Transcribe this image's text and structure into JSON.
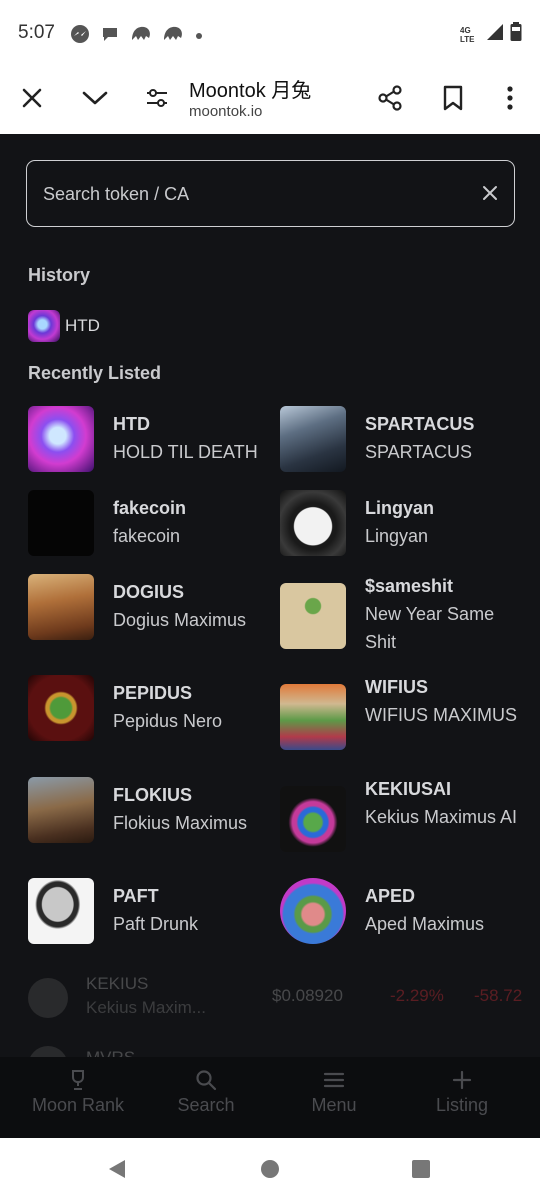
{
  "status": {
    "time": "5:07",
    "network": "4G LTE"
  },
  "browser": {
    "title": "Moontok 月兔",
    "url": "moontok.io"
  },
  "search": {
    "placeholder": "Search token / CA"
  },
  "history": {
    "title": "History",
    "items": [
      {
        "label": "HTD"
      }
    ]
  },
  "recent": {
    "title": "Recently Listed",
    "tokens": [
      {
        "symbol": "HTD",
        "name": "HOLD TIL DEATH"
      },
      {
        "symbol": "SPARTACUS",
        "name": "SPARTACUS"
      },
      {
        "symbol": "fakecoin",
        "name": "fakecoin"
      },
      {
        "symbol": "Lingyan",
        "name": "Lingyan"
      },
      {
        "symbol": "DOGIUS",
        "name": "Dogius Maximus"
      },
      {
        "symbol": "$sameshit",
        "name": "New Year Same Shit"
      },
      {
        "symbol": "PEPIDUS",
        "name": "Pepidus Nero"
      },
      {
        "symbol": "WIFIUS",
        "name": "WIFIUS MAXIMUS"
      },
      {
        "symbol": "FLOKIUS",
        "name": "Flokius Maximus"
      },
      {
        "symbol": "KEKIUSAI",
        "name": "Kekius Maximus AI"
      },
      {
        "symbol": "PAFT",
        "name": "Paft Drunk"
      },
      {
        "symbol": "APED",
        "name": "Aped Maximus"
      }
    ]
  },
  "background_rows": [
    {
      "symbol": "KEKIUS",
      "name": "Kekius Maxim...",
      "price": "$0.08920",
      "change1": "-2.29%",
      "change2": "-58.72"
    },
    {
      "symbol": "MVRS",
      "name": "",
      "price": "",
      "change1": "",
      "change2": ""
    }
  ],
  "tabs": [
    {
      "label": "Moon Rank",
      "icon": "trophy-icon"
    },
    {
      "label": "Search",
      "icon": "search-icon"
    },
    {
      "label": "Menu",
      "icon": "menu-icon"
    },
    {
      "label": "Listing",
      "icon": "plus-icon"
    }
  ],
  "colors": {
    "background": "#121316",
    "text_primary": "#d8d9dc",
    "text_secondary": "#c9cacd",
    "negative": "#e0303a"
  }
}
